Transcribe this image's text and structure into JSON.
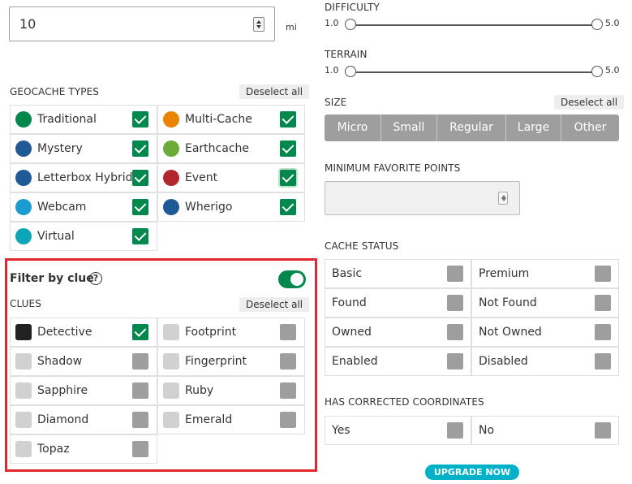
{
  "distance": {
    "value": "10",
    "unit": "mi"
  },
  "geocache_types": {
    "header": "GEOCACHE TYPES",
    "deselect_label": "Deselect all",
    "items": [
      {
        "label": "Traditional",
        "icon": "traditional-icon",
        "color": "#02874d",
        "checked": true
      },
      {
        "label": "Multi-Cache",
        "icon": "multi-cache-icon",
        "color": "#e98300",
        "checked": true
      },
      {
        "label": "Mystery",
        "icon": "mystery-icon",
        "color": "#1f5a96",
        "checked": true
      },
      {
        "label": "Earthcache",
        "icon": "earthcache-icon",
        "color": "#6bab38",
        "checked": true
      },
      {
        "label": "Letterbox Hybrid",
        "icon": "letterbox-icon",
        "color": "#1f5a96",
        "checked": true
      },
      {
        "label": "Event",
        "icon": "event-icon",
        "color": "#b2272d",
        "checked": true
      },
      {
        "label": "Webcam",
        "icon": "webcam-icon",
        "color": "#1c9bd1",
        "checked": true
      },
      {
        "label": "Wherigo",
        "icon": "wherigo-icon",
        "color": "#1f5a96",
        "checked": true
      },
      {
        "label": "Virtual",
        "icon": "virtual-icon",
        "color": "#0fa5b9",
        "checked": true
      }
    ]
  },
  "filter_by_clue": {
    "title": "Filter by clue",
    "help_symbol": "?",
    "enabled": true,
    "clues_header": "CLUES",
    "deselect_label": "Deselect all",
    "items": [
      {
        "label": "Detective",
        "icon": "detective-icon",
        "checked": true
      },
      {
        "label": "Footprint",
        "icon": "footprint-icon",
        "checked": false
      },
      {
        "label": "Shadow",
        "icon": "shadow-icon",
        "checked": false
      },
      {
        "label": "Fingerprint",
        "icon": "fingerprint-icon",
        "checked": false
      },
      {
        "label": "Sapphire",
        "icon": "sapphire-icon",
        "checked": false
      },
      {
        "label": "Ruby",
        "icon": "ruby-icon",
        "checked": false
      },
      {
        "label": "Diamond",
        "icon": "diamond-icon",
        "checked": false
      },
      {
        "label": "Emerald",
        "icon": "emerald-icon",
        "checked": false
      },
      {
        "label": "Topaz",
        "icon": "topaz-icon",
        "checked": false
      }
    ]
  },
  "difficulty": {
    "label": "DIFFICULTY",
    "min": "1.0",
    "max": "5.0",
    "range": [
      1.0,
      5.0
    ]
  },
  "terrain": {
    "label": "TERRAIN",
    "min": "1.0",
    "max": "5.0",
    "range": [
      1.0,
      5.0
    ]
  },
  "size": {
    "label": "SIZE",
    "deselect_label": "Deselect all",
    "options": [
      "Micro",
      "Small",
      "Regular",
      "Large",
      "Other"
    ]
  },
  "min_favorite_points": {
    "label": "MINIMUM FAVORITE POINTS",
    "value": ""
  },
  "cache_status": {
    "label": "CACHE STATUS",
    "items": [
      "Basic",
      "Premium",
      "Found",
      "Not Found",
      "Owned",
      "Not Owned",
      "Enabled",
      "Disabled"
    ]
  },
  "corrected_coords": {
    "label": "HAS CORRECTED COORDINATES",
    "items": [
      "Yes",
      "No"
    ]
  },
  "upgrade_label": "UPGRADE NOW",
  "colors": {
    "accent": "#02874d",
    "highlight": "#e0282e",
    "upgrade": "#00b1c7"
  }
}
